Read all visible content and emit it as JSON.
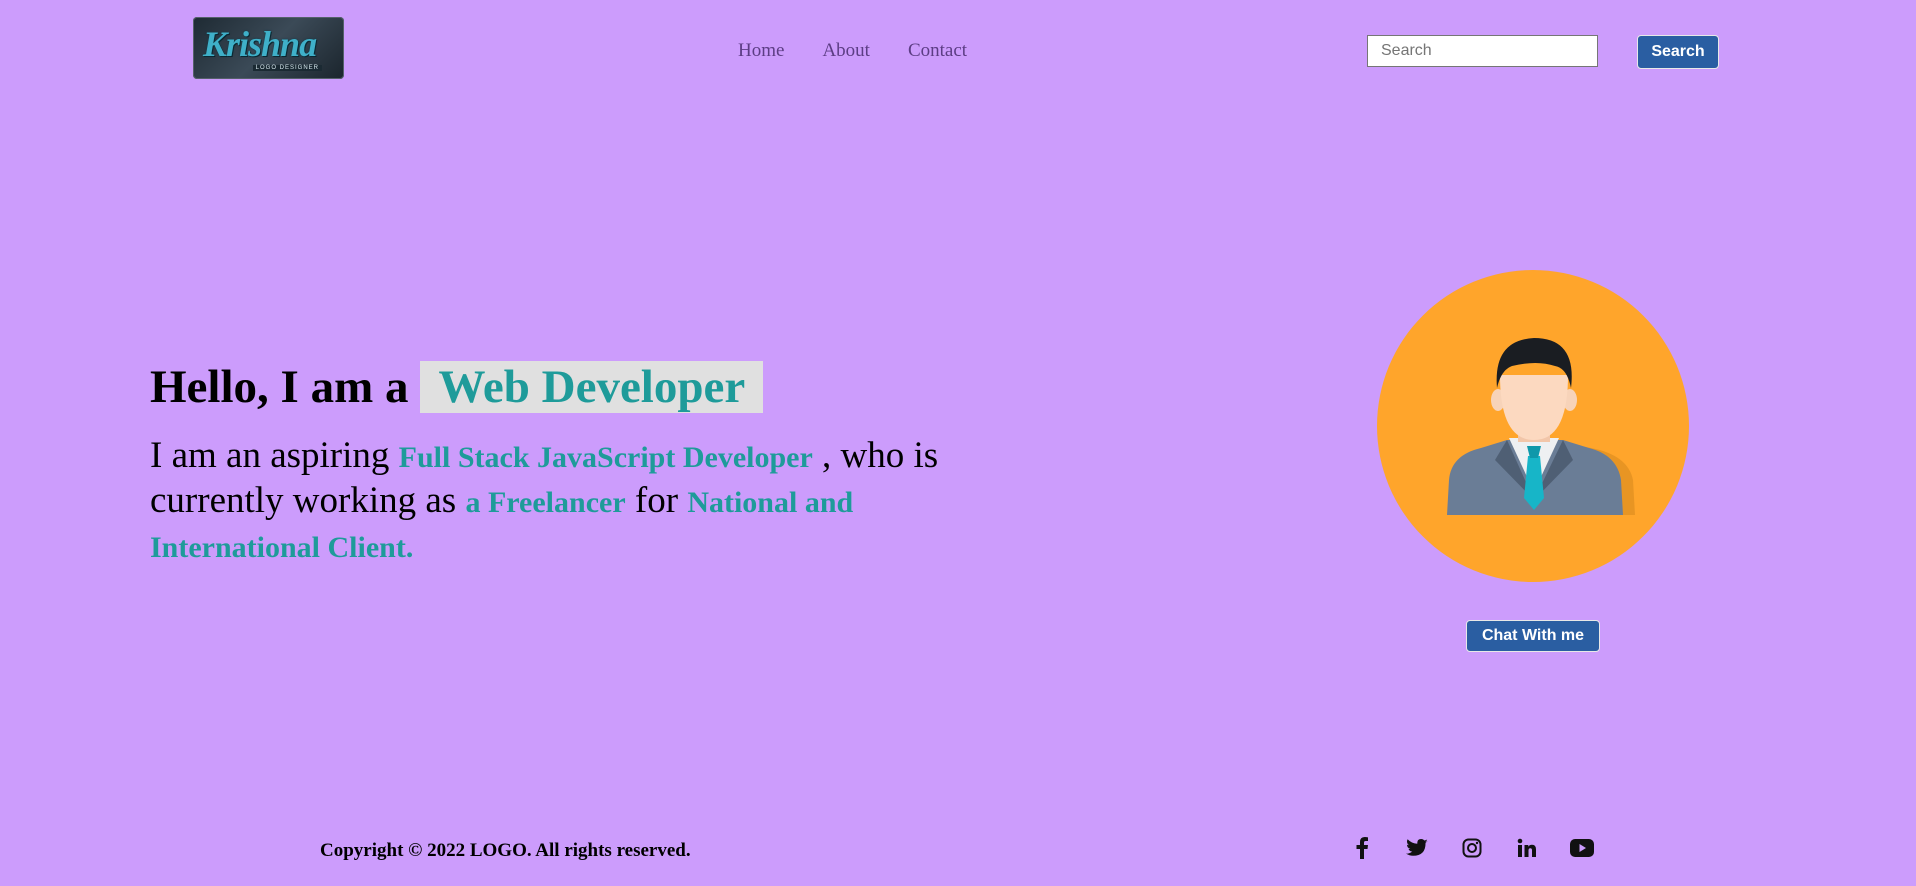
{
  "header": {
    "logo_text": "Krishna",
    "logo_sub": "LOGO DESIGNER",
    "nav": [
      {
        "label": "Home"
      },
      {
        "label": "About"
      },
      {
        "label": "Contact"
      }
    ],
    "search_placeholder": "Search",
    "search_button": "Search"
  },
  "hero": {
    "greeting": "Hello, I am a",
    "role": "Web Developer",
    "intro_1": "I am an aspiring ",
    "highlight_1": "Full Stack JavaScript Developer",
    "intro_2": " , who is currently working as ",
    "highlight_2": "a Freelancer",
    "intro_3": " for ",
    "highlight_3": "National and International Client."
  },
  "profile": {
    "chat_button": "Chat With me"
  },
  "footer": {
    "copyright": "Copyright © 2022 LOGO. All rights reserved.",
    "socials": [
      "facebook-icon",
      "twitter-icon",
      "instagram-icon",
      "linkedin-icon",
      "youtube-icon"
    ]
  },
  "colors": {
    "background": "#cc9cfc",
    "accent_teal": "#1e9b9a",
    "button_blue": "#2a5ea2",
    "avatar_bg": "#ffa52b"
  }
}
